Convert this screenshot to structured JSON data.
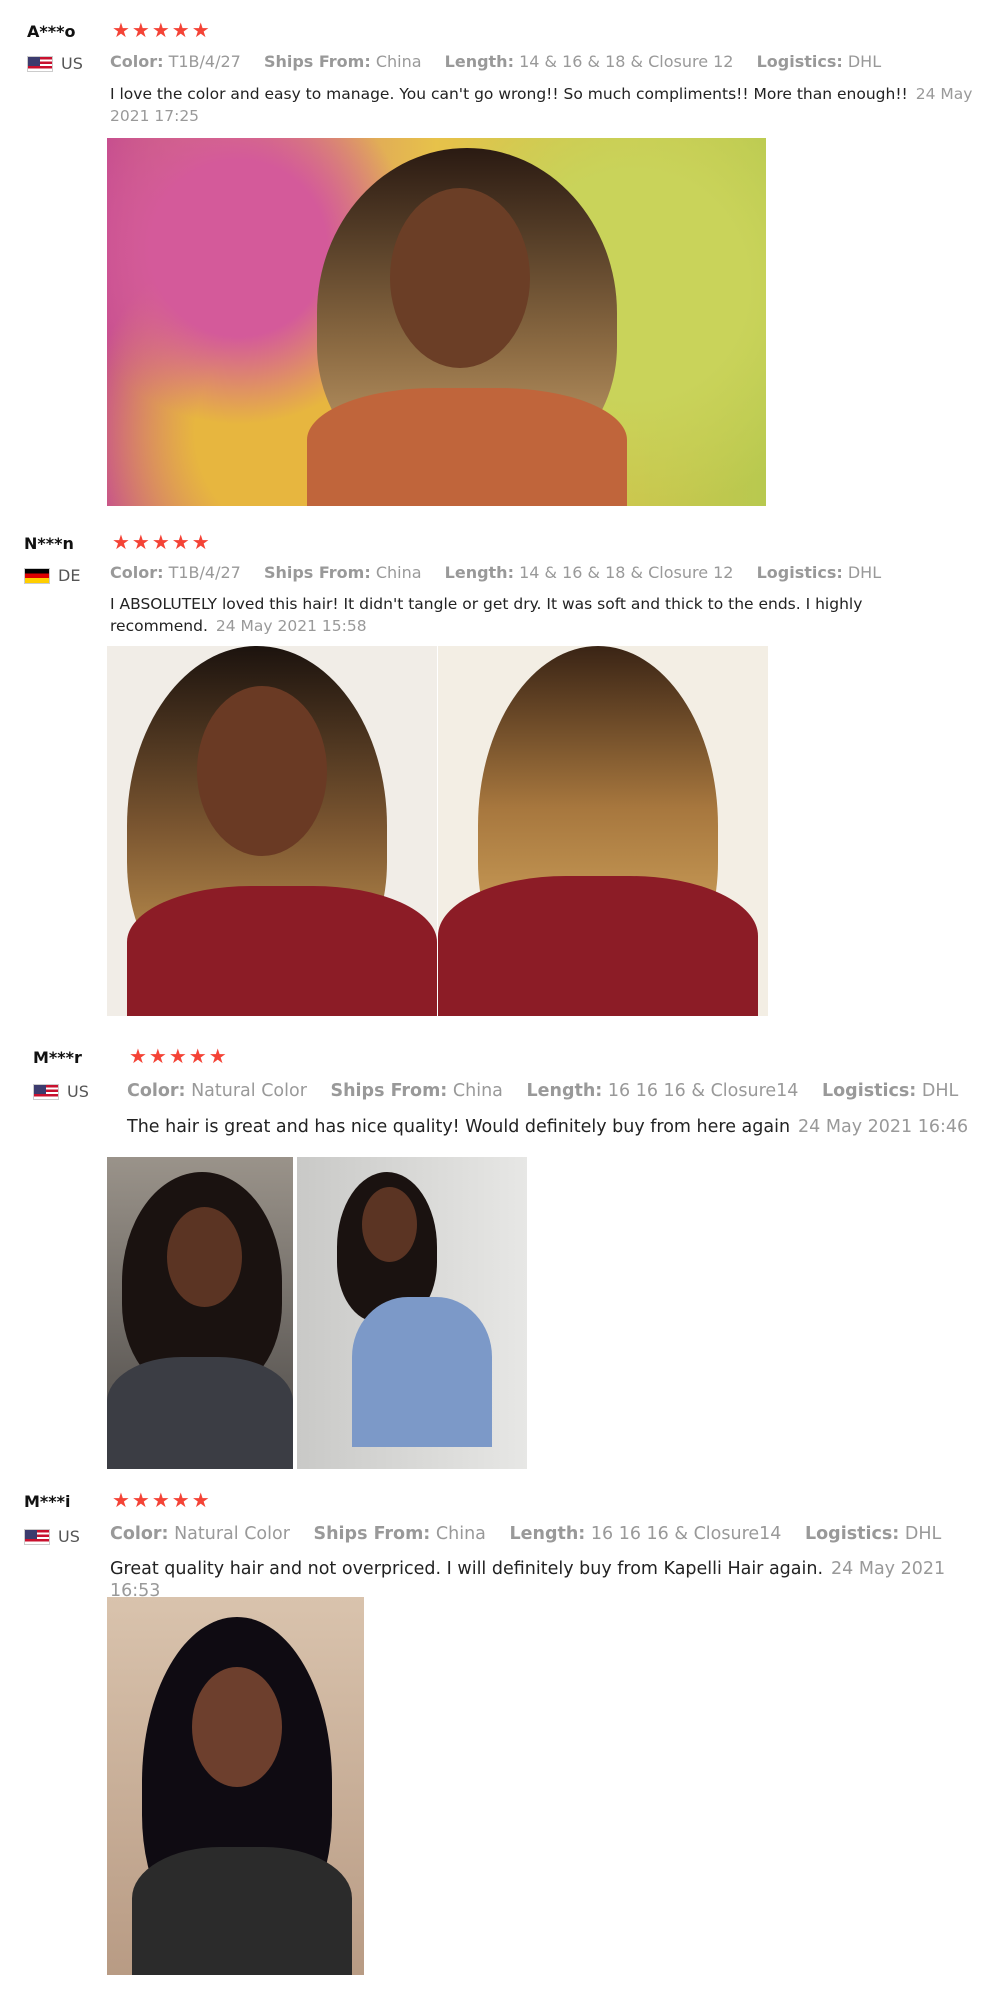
{
  "reviews": [
    {
      "user": "A***o",
      "country": "US",
      "stars": "★★★★★",
      "meta": {
        "color_label": "Color:",
        "color_value": "T1B/4/27",
        "ships_label": "Ships From:",
        "ships_value": "China",
        "length_label": "Length:",
        "length_value": "14 & 16 & 18 & Closure 12",
        "logistics_label": "Logistics:",
        "logistics_value": "DHL"
      },
      "text": "I love the color and easy to manage. You can't go wrong!! So much compliments!! More than enough!!",
      "date": "24 May 2021 17:25"
    },
    {
      "user": "N***n",
      "country": "DE",
      "stars": "★★★★★",
      "meta": {
        "color_label": "Color:",
        "color_value": "T1B/4/27",
        "ships_label": "Ships From:",
        "ships_value": "China",
        "length_label": "Length:",
        "length_value": "14 & 16 & 18 & Closure 12",
        "logistics_label": "Logistics:",
        "logistics_value": "DHL"
      },
      "text": "I ABSOLUTELY loved this hair! It didn't tangle or get dry. It was soft and thick to the ends. I highly recommend.",
      "date": "24 May 2021 15:58"
    },
    {
      "user": "M***r",
      "country": "US",
      "stars": "★★★★★",
      "meta": {
        "color_label": "Color:",
        "color_value": "Natural Color",
        "ships_label": "Ships From:",
        "ships_value": "China",
        "length_label": "Length:",
        "length_value": "16 16 16 & Closure14",
        "logistics_label": "Logistics:",
        "logistics_value": "DHL"
      },
      "text": "The hair is great and has nice quality! Would definitely buy from here again",
      "date": "24 May 2021 16:46"
    },
    {
      "user": "M***i",
      "country": "US",
      "stars": "★★★★★",
      "meta": {
        "color_label": "Color:",
        "color_value": "Natural Color",
        "ships_label": "Ships From:",
        "ships_value": "China",
        "length_label": "Length:",
        "length_value": "16 16 16 & Closure14",
        "logistics_label": "Logistics:",
        "logistics_value": "DHL"
      },
      "text": "Great quality hair and not overpriced. I will definitely buy from Kapelli Hair again.",
      "date": "24 May 2021 16:53"
    }
  ]
}
